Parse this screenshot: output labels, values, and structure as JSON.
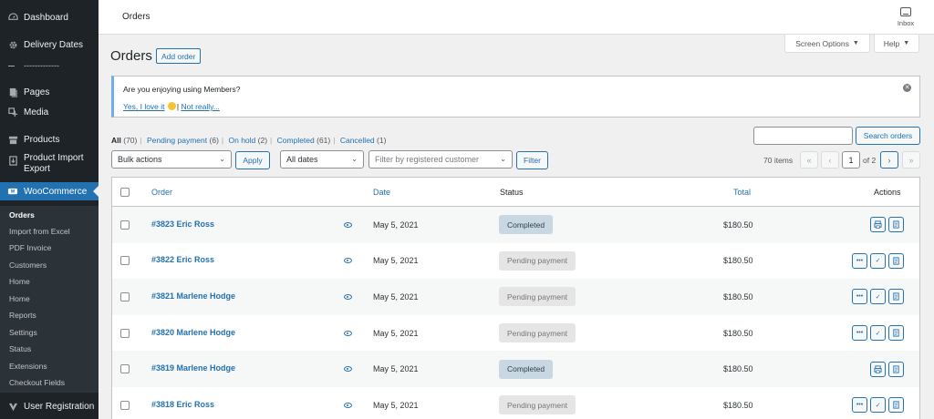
{
  "sidebar": {
    "items": [
      {
        "label": "Dashboard",
        "icon": "dashboard-icon"
      },
      {
        "label": "Delivery Dates",
        "icon": "gear-icon"
      },
      {
        "label": "-------------",
        "icon": "separator"
      },
      {
        "label": "Pages",
        "icon": "pages-icon"
      },
      {
        "label": "Media",
        "icon": "media-icon"
      },
      {
        "label": "Products",
        "icon": "archive-icon"
      },
      {
        "label": "Product Import Export",
        "icon": "import-icon"
      },
      {
        "label": "WooCommerce",
        "icon": "woo-icon"
      },
      {
        "label": "User Registration",
        "icon": "user-registration-icon"
      }
    ],
    "submenu": [
      "Orders",
      "Import from Excel",
      "PDF Invoice",
      "Customers",
      "Home",
      "Home",
      "Reports",
      "Settings",
      "Status",
      "Extensions",
      "Checkout Fields"
    ],
    "active_color": "#2271b1"
  },
  "header": {
    "title": "Orders",
    "inbox_label": "Inbox"
  },
  "tabs": {
    "screen_options": "Screen Options",
    "help": "Help"
  },
  "page": {
    "title": "Orders",
    "add_button": "Add order"
  },
  "notice": {
    "text": "Are you enjoying using Members?",
    "yes_link": "Yes, I love it",
    "sep": "|",
    "no_link": "Not really..."
  },
  "status_filters": [
    {
      "label": "All",
      "count": "(70)"
    },
    {
      "label": "Pending payment",
      "count": "(6)"
    },
    {
      "label": "On hold",
      "count": "(2)"
    },
    {
      "label": "Completed",
      "count": "(61)"
    },
    {
      "label": "Cancelled",
      "count": "(1)"
    }
  ],
  "search": {
    "placeholder": "",
    "button": "Search orders"
  },
  "tablenav": {
    "bulk_actions": "Bulk actions",
    "apply": "Apply",
    "dates": "All dates",
    "customer_placeholder": "Filter by registered customer",
    "filter": "Filter",
    "items": "70 items",
    "first": "«",
    "prev": "‹",
    "current_page": "1",
    "of_pages": "of 2",
    "next": "›",
    "last": "»"
  },
  "table": {
    "columns": {
      "order": "Order",
      "date": "Date",
      "status": "Status",
      "total": "Total",
      "actions": "Actions"
    },
    "rows": [
      {
        "order": "#3823 Eric Ross",
        "date": "May 5, 2021",
        "status": "Completed",
        "status_type": "completed",
        "total": "$180.50"
      },
      {
        "order": "#3822 Eric Ross",
        "date": "May 5, 2021",
        "status": "Pending payment",
        "status_type": "pending",
        "total": "$180.50"
      },
      {
        "order": "#3821 Marlene Hodge",
        "date": "May 5, 2021",
        "status": "Pending payment",
        "status_type": "pending",
        "total": "$180.50"
      },
      {
        "order": "#3820 Marlene Hodge",
        "date": "May 5, 2021",
        "status": "Pending payment",
        "status_type": "pending",
        "total": "$180.50"
      },
      {
        "order": "#3819 Marlene Hodge",
        "date": "May 5, 2021",
        "status": "Completed",
        "status_type": "completed",
        "total": "$180.50"
      },
      {
        "order": "#3818 Eric Ross",
        "date": "May 5, 2021",
        "status": "Pending payment",
        "status_type": "pending",
        "total": "$180.50"
      }
    ],
    "action_labels": {
      "more": "•••",
      "complete": "✓"
    }
  }
}
